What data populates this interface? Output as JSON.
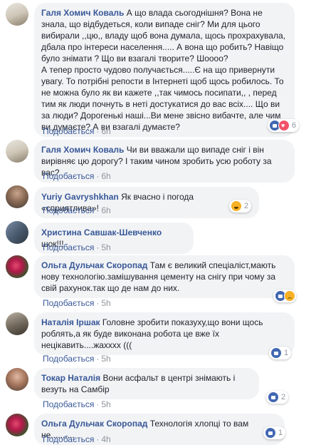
{
  "like_label": "Подобається",
  "separator": "·",
  "comments": [
    {
      "author": "Галя Хомич Коваль",
      "text": "А що влада сьогоднішня? Вона не знала, що відбудеться, коли випаде сніг? Ми для цього вибирали ,,цю,, владу щоб вона думала, щось прохрахувала, дбала про інтереси населення..... А вона що робить? Навіщо було знімати ? Що ви взагалі творите? Шоооо?\nА тепер просто чудово получається.....Є на що привернути увагу. То потрібні репости в Інтернеті щоб щось робилось. То не можна було як ви кажете ,,так чимось посипати,, , перед тим як люди почнуть в неті достукатися до вас всіх.... Що ви за люди? Дорогенькі наші...Ви мене звісно вибачте, але чим ви думаєте? А ви взагалі думаєте?",
      "time": "6h",
      "reactions": [
        "like",
        "love"
      ],
      "reaction_count": "6"
    },
    {
      "author": "Галя Хомич Коваль",
      "text": "Чи ви вважали що випаде сніг і він вирівняє цю дорогу? І таким чином зробить усю роботу за вас?",
      "time": "6h",
      "reactions": [],
      "reaction_count": ""
    },
    {
      "author": "Yuriy Gavryshkhan",
      "text": "Як вчасно і погода «сприятлива»!",
      "time": "6h",
      "reactions": [
        "haha"
      ],
      "reaction_count": "2"
    },
    {
      "author": "Христина Савшак-Шевченко",
      "text": "шок!!!",
      "time": "5h",
      "reactions": [],
      "reaction_count": ""
    },
    {
      "author": "Ольга Дульчак Скоропад",
      "text": "Там є великий спеціаліст,мають нову технологію.замішування цементу на снігу при чому за свій рахунок.так що де нам до них.",
      "time": "5h",
      "reactions": [
        "like",
        "sad"
      ],
      "reaction_count": ""
    },
    {
      "author": "Наталія Іршак",
      "text": "Головне зробити показуху,що вони щось роблять,а як буде виконана робота це вже їх нецікавить....жахххх (((",
      "time": "5h",
      "reactions": [
        "like"
      ],
      "reaction_count": "1"
    },
    {
      "author": "Токар Наталія",
      "text": "Вони асфальт в центрі знімають і везуть на Самбір",
      "time": "5h",
      "reactions": [
        "like"
      ],
      "reaction_count": "2"
    },
    {
      "author": "Ольга Дульчак Скоропад",
      "text": "Технологія хлопці то вам не..........",
      "time": "4h",
      "reactions": [
        "like"
      ],
      "reaction_count": "1"
    }
  ]
}
